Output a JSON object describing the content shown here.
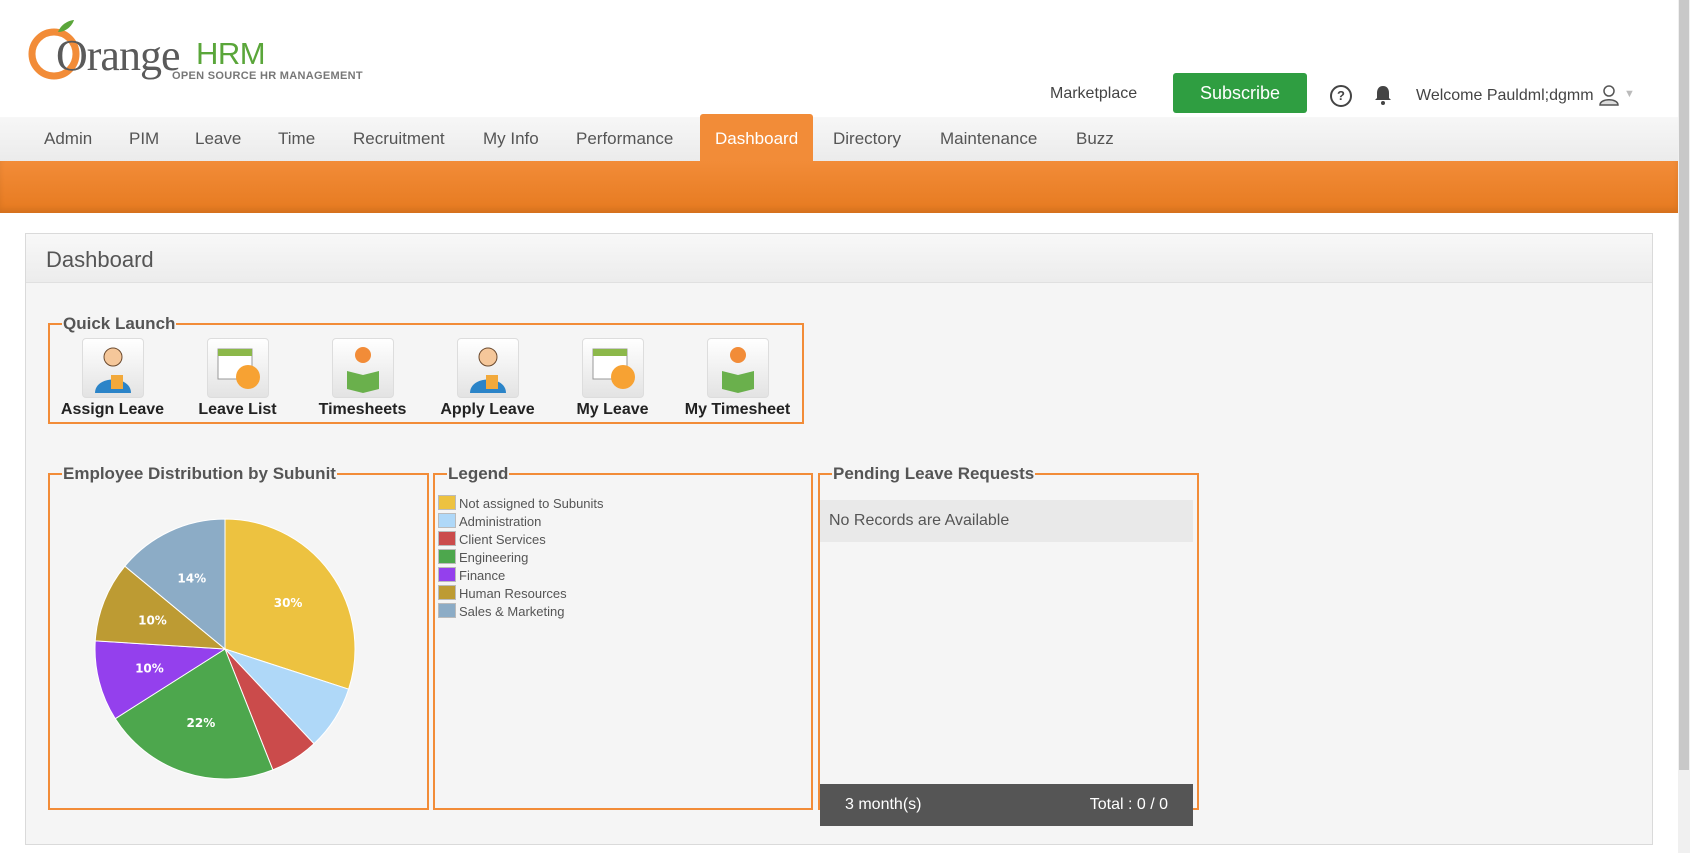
{
  "logo": {
    "word": "Orange",
    "hrm": "HRM",
    "tagline": "OPEN SOURCE HR MANAGEMENT"
  },
  "header": {
    "marketplace": "Marketplace",
    "subscribe": "Subscribe",
    "help_icon": "question-circle",
    "bell_icon": "bell",
    "welcome": "Welcome Pauldml;dgmm"
  },
  "nav": {
    "items": [
      "Admin",
      "PIM",
      "Leave",
      "Time",
      "Recruitment",
      "My Info",
      "Performance",
      "Dashboard",
      "Directory",
      "Maintenance",
      "Buzz"
    ],
    "active": "Dashboard"
  },
  "panel": {
    "title": "Dashboard"
  },
  "quick_launch": {
    "title": "Quick Launch",
    "items": [
      "Assign Leave",
      "Leave List",
      "Timesheets",
      "Apply Leave",
      "My Leave",
      "My Timesheet"
    ]
  },
  "distribution": {
    "title": "Employee Distribution by Subunit",
    "legend_title": "Legend"
  },
  "pending": {
    "title": "Pending Leave Requests",
    "empty": "No Records are Available",
    "period": "3 month(s)",
    "total": "Total : 0 / 0"
  },
  "chart_data": {
    "type": "pie",
    "categories": [
      "Not assigned to Subunits",
      "Administration",
      "Client Services",
      "Engineering",
      "Finance",
      "Human Resources",
      "Sales & Marketing"
    ],
    "values": [
      30,
      8,
      6,
      22,
      10,
      10,
      14
    ],
    "labels": [
      "30%",
      "",
      "",
      "22%",
      "10%",
      "10%",
      "14%"
    ],
    "colors": [
      "#edc240",
      "#afd8f8",
      "#cb4b4b",
      "#4da74d",
      "#9440ed",
      "#bd9b33",
      "#8cacc6"
    ]
  }
}
